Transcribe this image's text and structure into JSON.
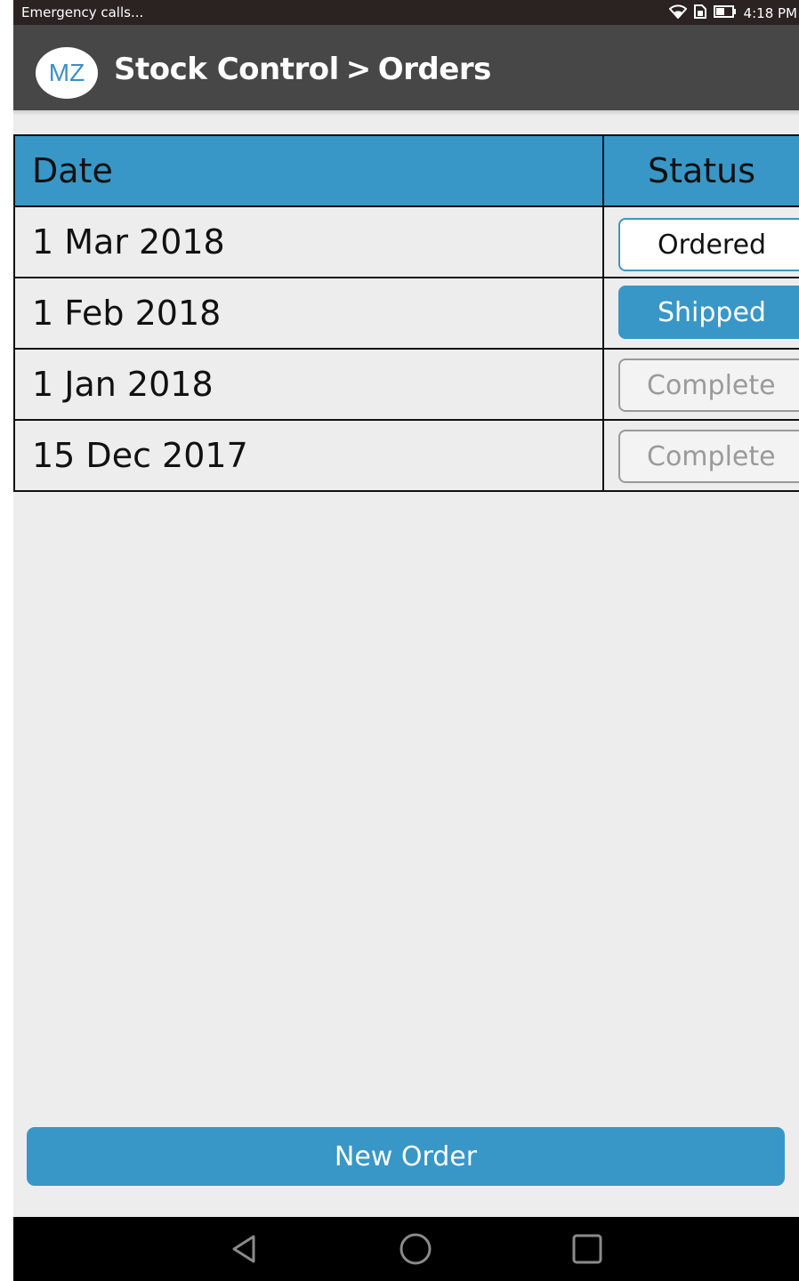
{
  "status_bar": {
    "notification_text": "Emergency calls...",
    "time": "4:18 PM",
    "icons": [
      "wifi-icon",
      "sim-icon",
      "battery-icon"
    ]
  },
  "app_bar": {
    "logo_text": "MZ",
    "breadcrumb_root": "Stock Control",
    "breadcrumb_separator": ">",
    "breadcrumb_current": "Orders"
  },
  "orders_table": {
    "columns": {
      "date": "Date",
      "status": "Status"
    },
    "rows": [
      {
        "date": "1 Mar 2018",
        "status": "Ordered"
      },
      {
        "date": "1 Feb 2018",
        "status": "Shipped"
      },
      {
        "date": "1 Jan 2018",
        "status": "Complete"
      },
      {
        "date": "15 Dec 2017",
        "status": "Complete"
      }
    ]
  },
  "actions": {
    "new_order_label": "New Order"
  },
  "nav_bar": {
    "icons": [
      "back-icon",
      "home-icon",
      "recents-icon"
    ]
  },
  "colors": {
    "accent": "#3897c6",
    "app_bar": "#474747",
    "status_bar": "#2b2321",
    "background": "#ededed"
  }
}
